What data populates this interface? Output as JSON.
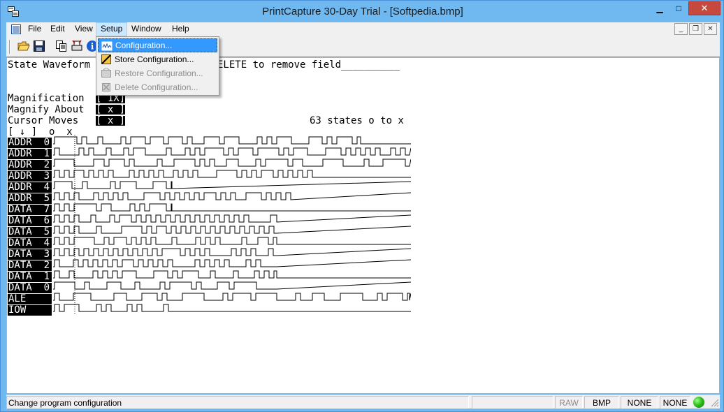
{
  "window": {
    "title": "PrintCapture 30-Day Trial - [Softpedia.bmp]",
    "minimize_glyph": "▁",
    "maximize_glyph": "□",
    "close_glyph": "✕"
  },
  "menubar": {
    "items": [
      "File",
      "Edit",
      "View",
      "Setup",
      "Window",
      "Help"
    ],
    "active": "Setup",
    "mdi_minimize": "_",
    "mdi_restore": "❐",
    "mdi_close": "✕"
  },
  "toolbar": {
    "icons": [
      "open-folder-icon",
      "save-icon",
      "copy-icon",
      "print-setup-icon",
      "info-icon"
    ]
  },
  "setup_menu": {
    "items": [
      {
        "label": "Configuration...",
        "icon": "configuration-icon",
        "state": "highlighted"
      },
      {
        "label": "Store Configuration...",
        "icon": "store-configuration-icon",
        "state": "enabled"
      },
      {
        "label": "Restore Configuration...",
        "icon": "restore-configuration-icon",
        "state": "disabled"
      },
      {
        "label": "Delete Configuration...",
        "icon": "delete-configuration-icon",
        "state": "disabled"
      }
    ]
  },
  "document": {
    "header_left": "State Waveform",
    "header_right": "ELETE to remove field__________",
    "magnification_label": "Magnification",
    "magnification_value": "[ 1X]",
    "magnify_about_label": "Magnify About",
    "magnify_about_value": "[ x ]",
    "cursor_moves_label": "Cursor Moves",
    "cursor_moves_value": "[ x ]",
    "states_text": "63 states o to x",
    "cursor_row": "[ ↓ ]  o  x",
    "signals": [
      "ADDR  0",
      "ADDR  1",
      "ADDR  2",
      "ADDR  3",
      "ADDR  4",
      "ADDR  5",
      "DATA  7",
      "DATA  6",
      "DATA  5",
      "DATA  4",
      "DATA  3",
      "DATA  2",
      "DATA  1",
      "DATA  0",
      "ALE",
      "IOW"
    ]
  },
  "statusbar": {
    "message": "Change program configuration",
    "raw": "RAW",
    "format": "BMP",
    "field1": "NONE",
    "field2": "NONE"
  },
  "colors": {
    "window_frame": "#6fb8f0",
    "menu_highlight": "#3399ff",
    "status_led": "#2fc01a",
    "close_button": "#c7483d"
  }
}
